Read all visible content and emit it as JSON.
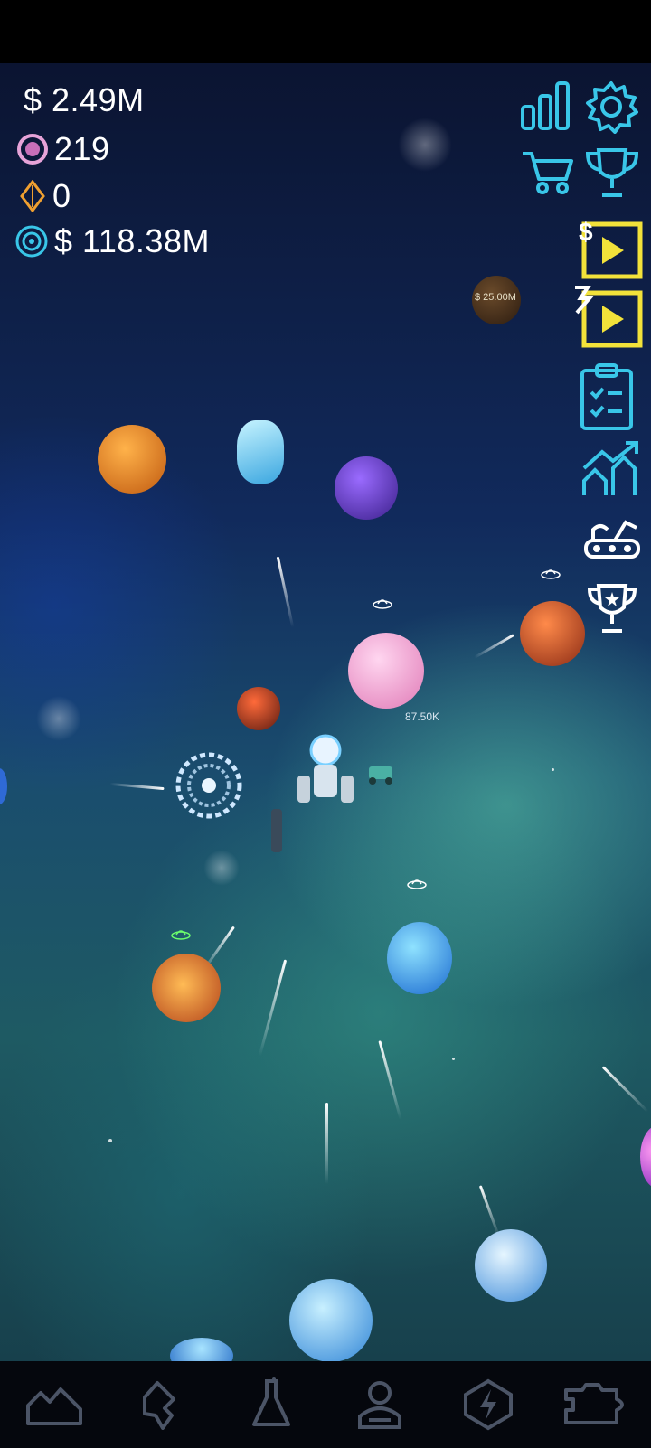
{
  "hud": {
    "money": "$ 2.49M",
    "gems": "219",
    "crystals": "0",
    "galaxy_value": "$ 118.38M"
  },
  "world": {
    "reward_planet_value": "$ 25.00M",
    "damage_popup": "87.50K"
  },
  "colors": {
    "accent_cyan": "#39c6e8",
    "ad_yellow": "#f2e23a",
    "nav_icon": "#4b5466"
  },
  "side_menu": [
    "stats-icon",
    "settings-icon",
    "shop-icon",
    "trophy-icon",
    "cash-ad-icon",
    "boost-ad-icon",
    "missions-icon",
    "upgrades-icon",
    "rover-icon",
    "achievements-icon"
  ],
  "bottom_nav": [
    "planets-tab",
    "drones-tab",
    "research-tab",
    "manager-tab",
    "boost-tab",
    "modules-tab"
  ]
}
